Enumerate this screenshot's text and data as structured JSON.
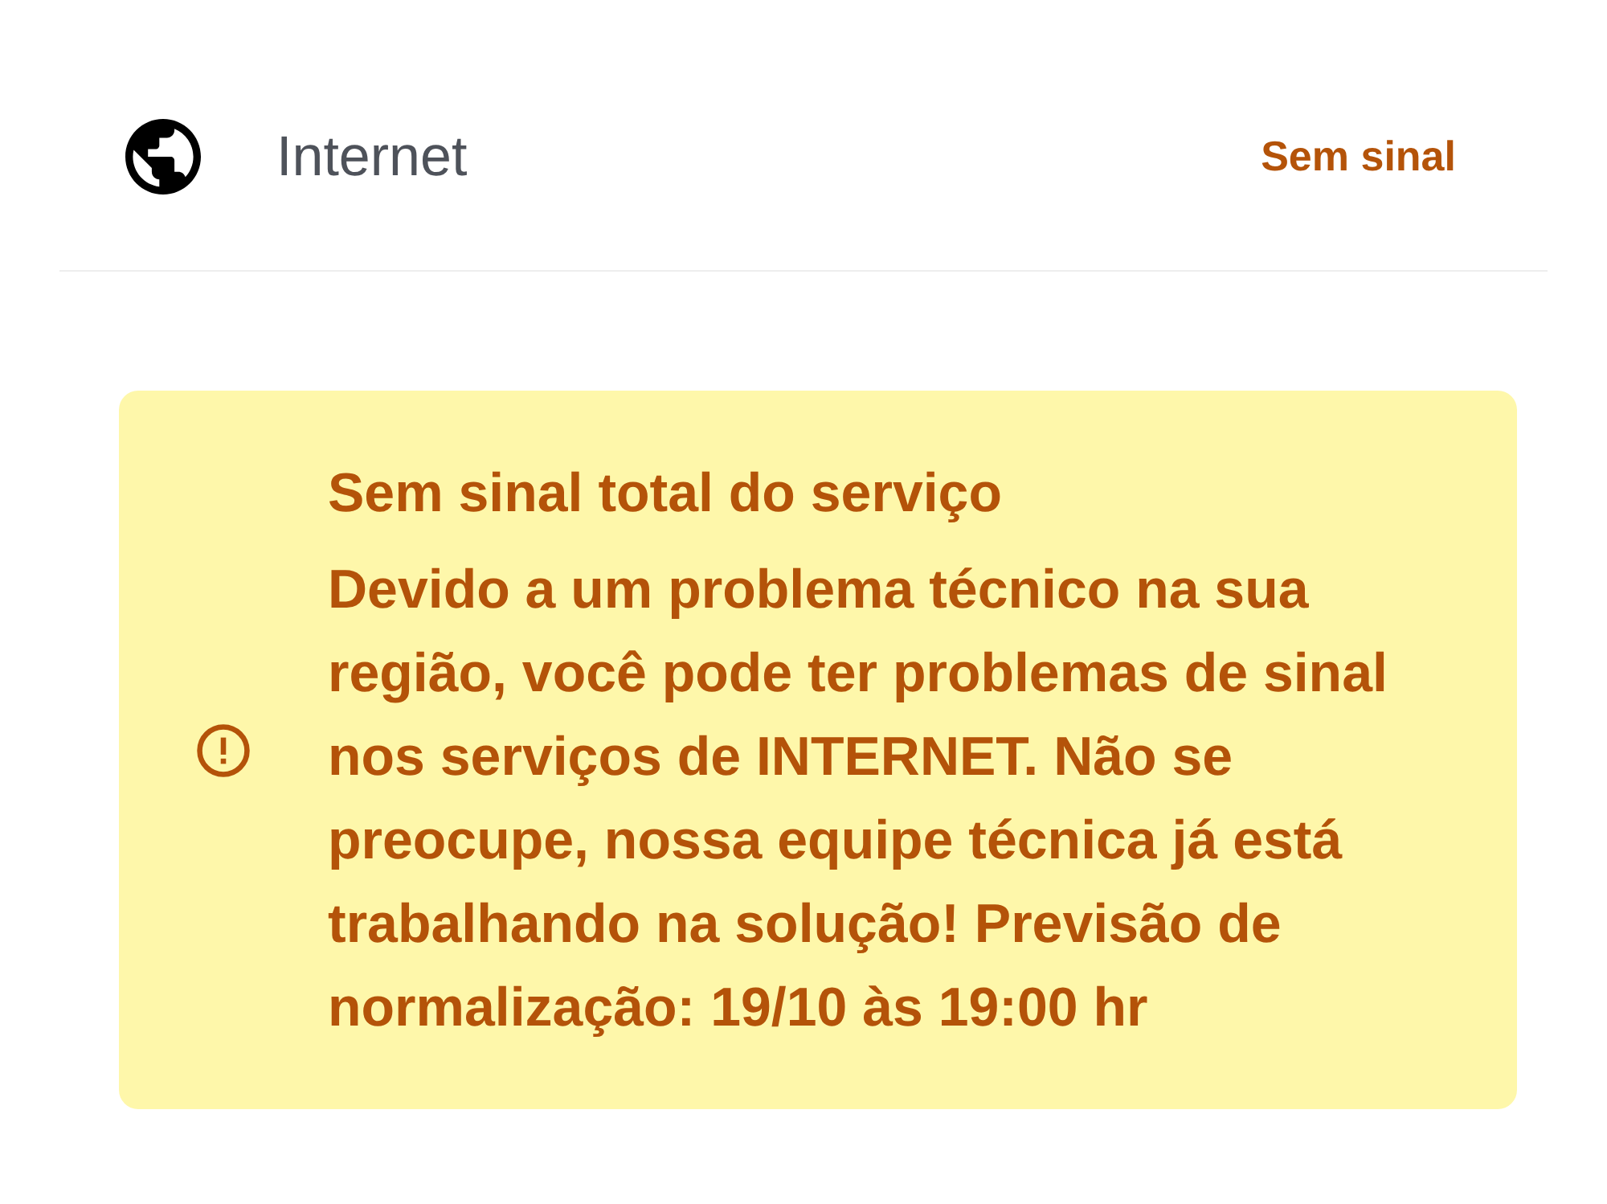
{
  "row": {
    "label": "Internet",
    "status": "Sem sinal"
  },
  "alert": {
    "title": "Sem sinal total do serviço",
    "message": "Devido a um problema técnico na sua região, você pode ter problemas de sinal nos serviços de INTERNET. Não se preocupe, nossa equipe técnica já está trabalhando na solução! Previsão de normalização: 19/10 às 19:00 hr"
  }
}
